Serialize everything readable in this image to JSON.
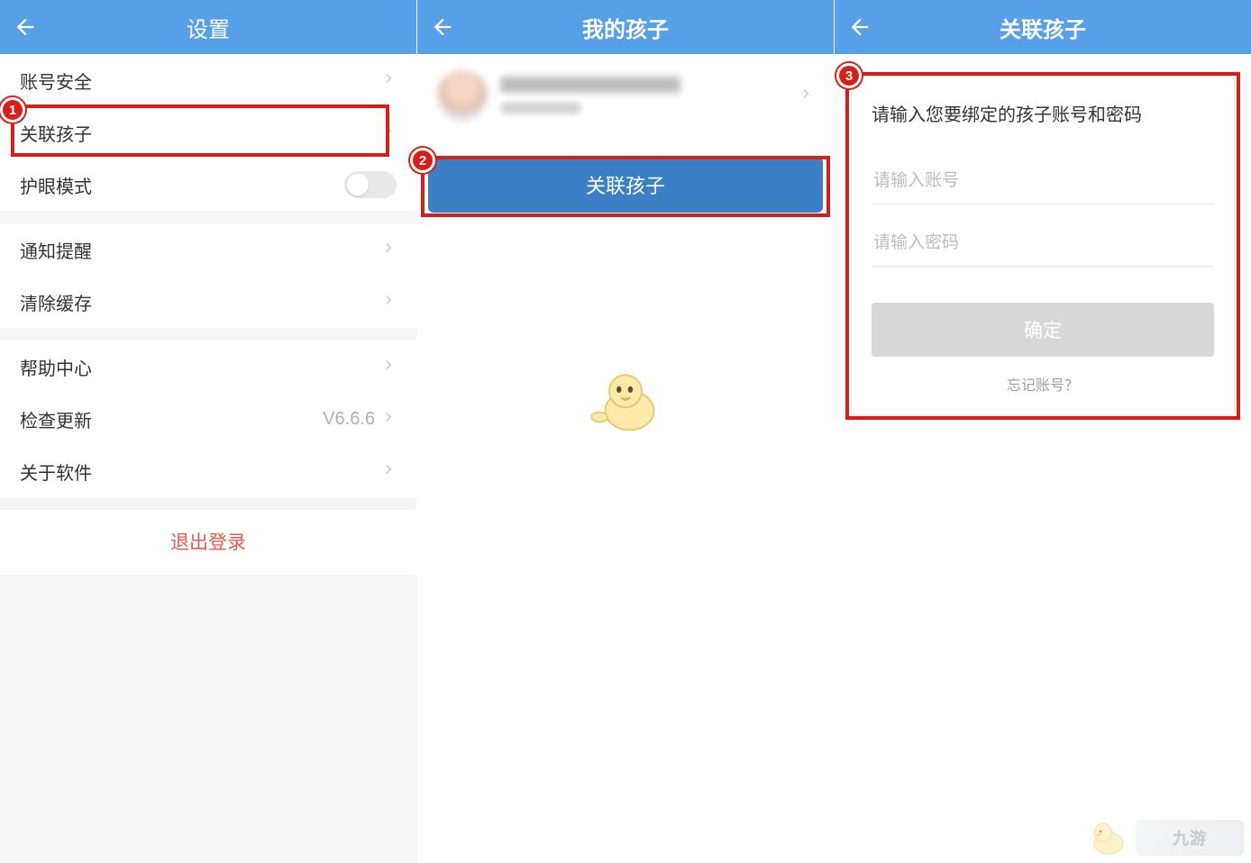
{
  "panel1": {
    "title": "设置",
    "rows": {
      "account_security": "账号安全",
      "associate_child": "关联孩子",
      "eye_mode": "护眼模式",
      "notify": "通知提醒",
      "clear_cache": "清除缓存",
      "help_center": "帮助中心",
      "check_update": "检查更新",
      "version": "V6.6.6",
      "about": "关于软件"
    },
    "logout": "退出登录",
    "badge": "1"
  },
  "panel2": {
    "title": "我的孩子",
    "associate_btn": "关联孩子",
    "badge": "2"
  },
  "panel3": {
    "title": "关联孩子",
    "card_title": "请输入您要绑定的孩子账号和密码",
    "placeholder_account": "请输入账号",
    "placeholder_password": "请输入密码",
    "confirm": "确定",
    "forgot": "忘记账号？",
    "badge": "3"
  },
  "watermark": "九游"
}
